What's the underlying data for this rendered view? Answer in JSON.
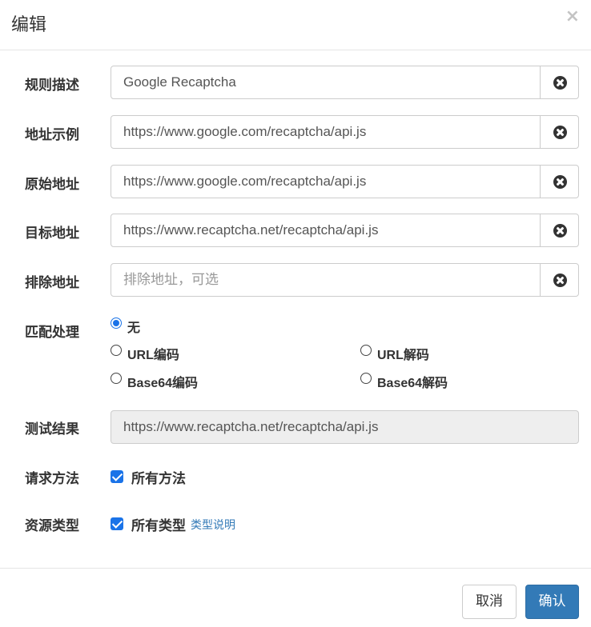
{
  "dialog": {
    "title": "编辑",
    "close_glyph": "×"
  },
  "fields": [
    {
      "label": "规则描述",
      "value": "Google Recaptcha",
      "placeholder": ""
    },
    {
      "label": "地址示例",
      "value": "https://www.google.com/recaptcha/api.js",
      "placeholder": ""
    },
    {
      "label": "原始地址",
      "value": "https://www.google.com/recaptcha/api.js",
      "placeholder": ""
    },
    {
      "label": "目标地址",
      "value": "https://www.recaptcha.net/recaptcha/api.js",
      "placeholder": ""
    },
    {
      "label": "排除地址",
      "value": "",
      "placeholder": "排除地址，可选"
    }
  ],
  "match": {
    "label": "匹配处理",
    "options": [
      {
        "label": "无",
        "checked": true
      },
      {
        "label": "URL编码",
        "checked": false
      },
      {
        "label": "URL解码",
        "checked": false
      },
      {
        "label": "Base64编码",
        "checked": false
      },
      {
        "label": "Base64解码",
        "checked": false
      }
    ]
  },
  "test_result": {
    "label": "测试结果",
    "value": "https://www.recaptcha.net/recaptcha/api.js"
  },
  "request_method": {
    "label": "请求方法",
    "option_label": "所有方法",
    "checked": true
  },
  "resource_type": {
    "label": "资源类型",
    "option_label": "所有类型",
    "checked": true,
    "help_link": "类型说明"
  },
  "footer": {
    "cancel_label": "取消",
    "confirm_label": "确认"
  },
  "colors": {
    "primary": "#337ab7",
    "checkbox": "#1a73e8",
    "readonly_bg": "#eeeeee"
  },
  "icons": {
    "clear": "times-circle-icon",
    "close": "close-icon"
  }
}
